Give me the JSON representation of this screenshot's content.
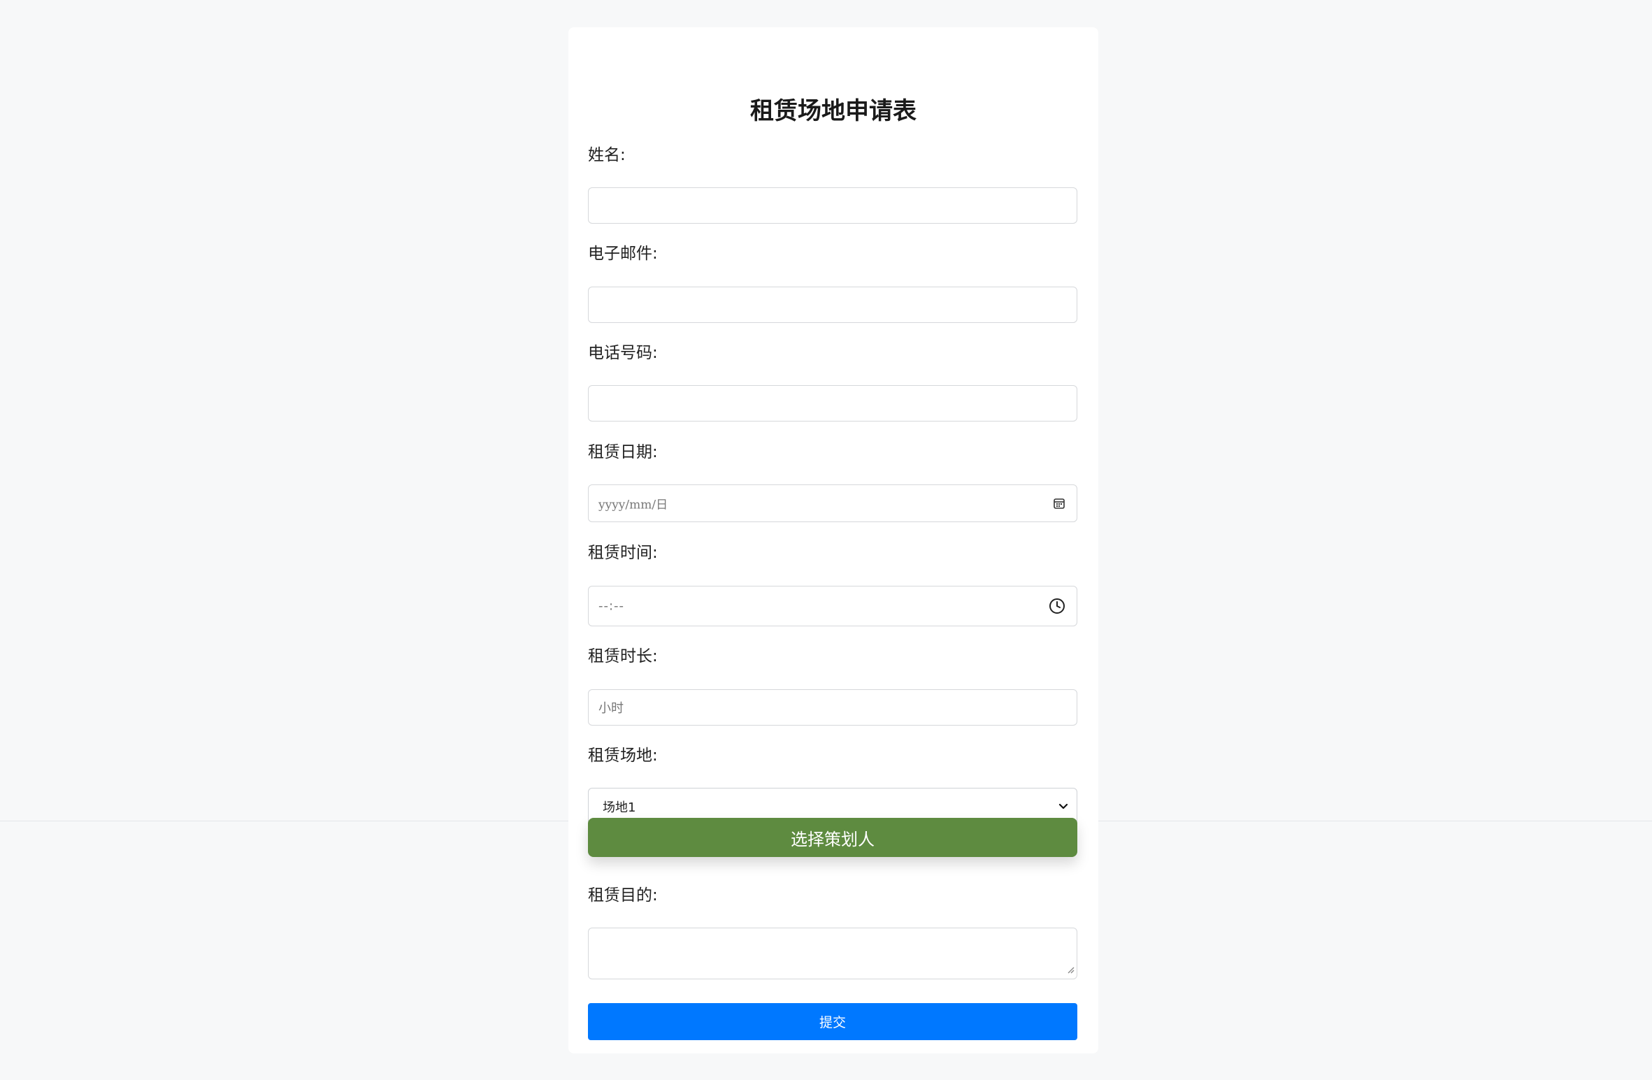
{
  "form": {
    "title": "租赁场地申请表",
    "name_label": "姓名:",
    "email_label": "电子邮件:",
    "phone_label": "电话号码:",
    "date_label": "租赁日期:",
    "date_placeholder": "yyyy/mm/日",
    "time_label": "租赁时间:",
    "time_placeholder": "--:--",
    "duration_label": "租赁时长:",
    "duration_placeholder": "小时",
    "venue_label": "租赁场地:",
    "venue_selected": "场地1",
    "planner_button": "选择策划人",
    "purpose_label": "租赁目的:",
    "submit_button": "提交"
  },
  "colors": {
    "planner_button_bg": "#5e8b40",
    "submit_button_bg": "#0078ff",
    "page_bg": "#f7f8f9"
  },
  "icons": {
    "date": "calendar-icon",
    "time": "clock-icon",
    "select": "chevron-down-icon",
    "textarea": "resize-grip-icon"
  }
}
